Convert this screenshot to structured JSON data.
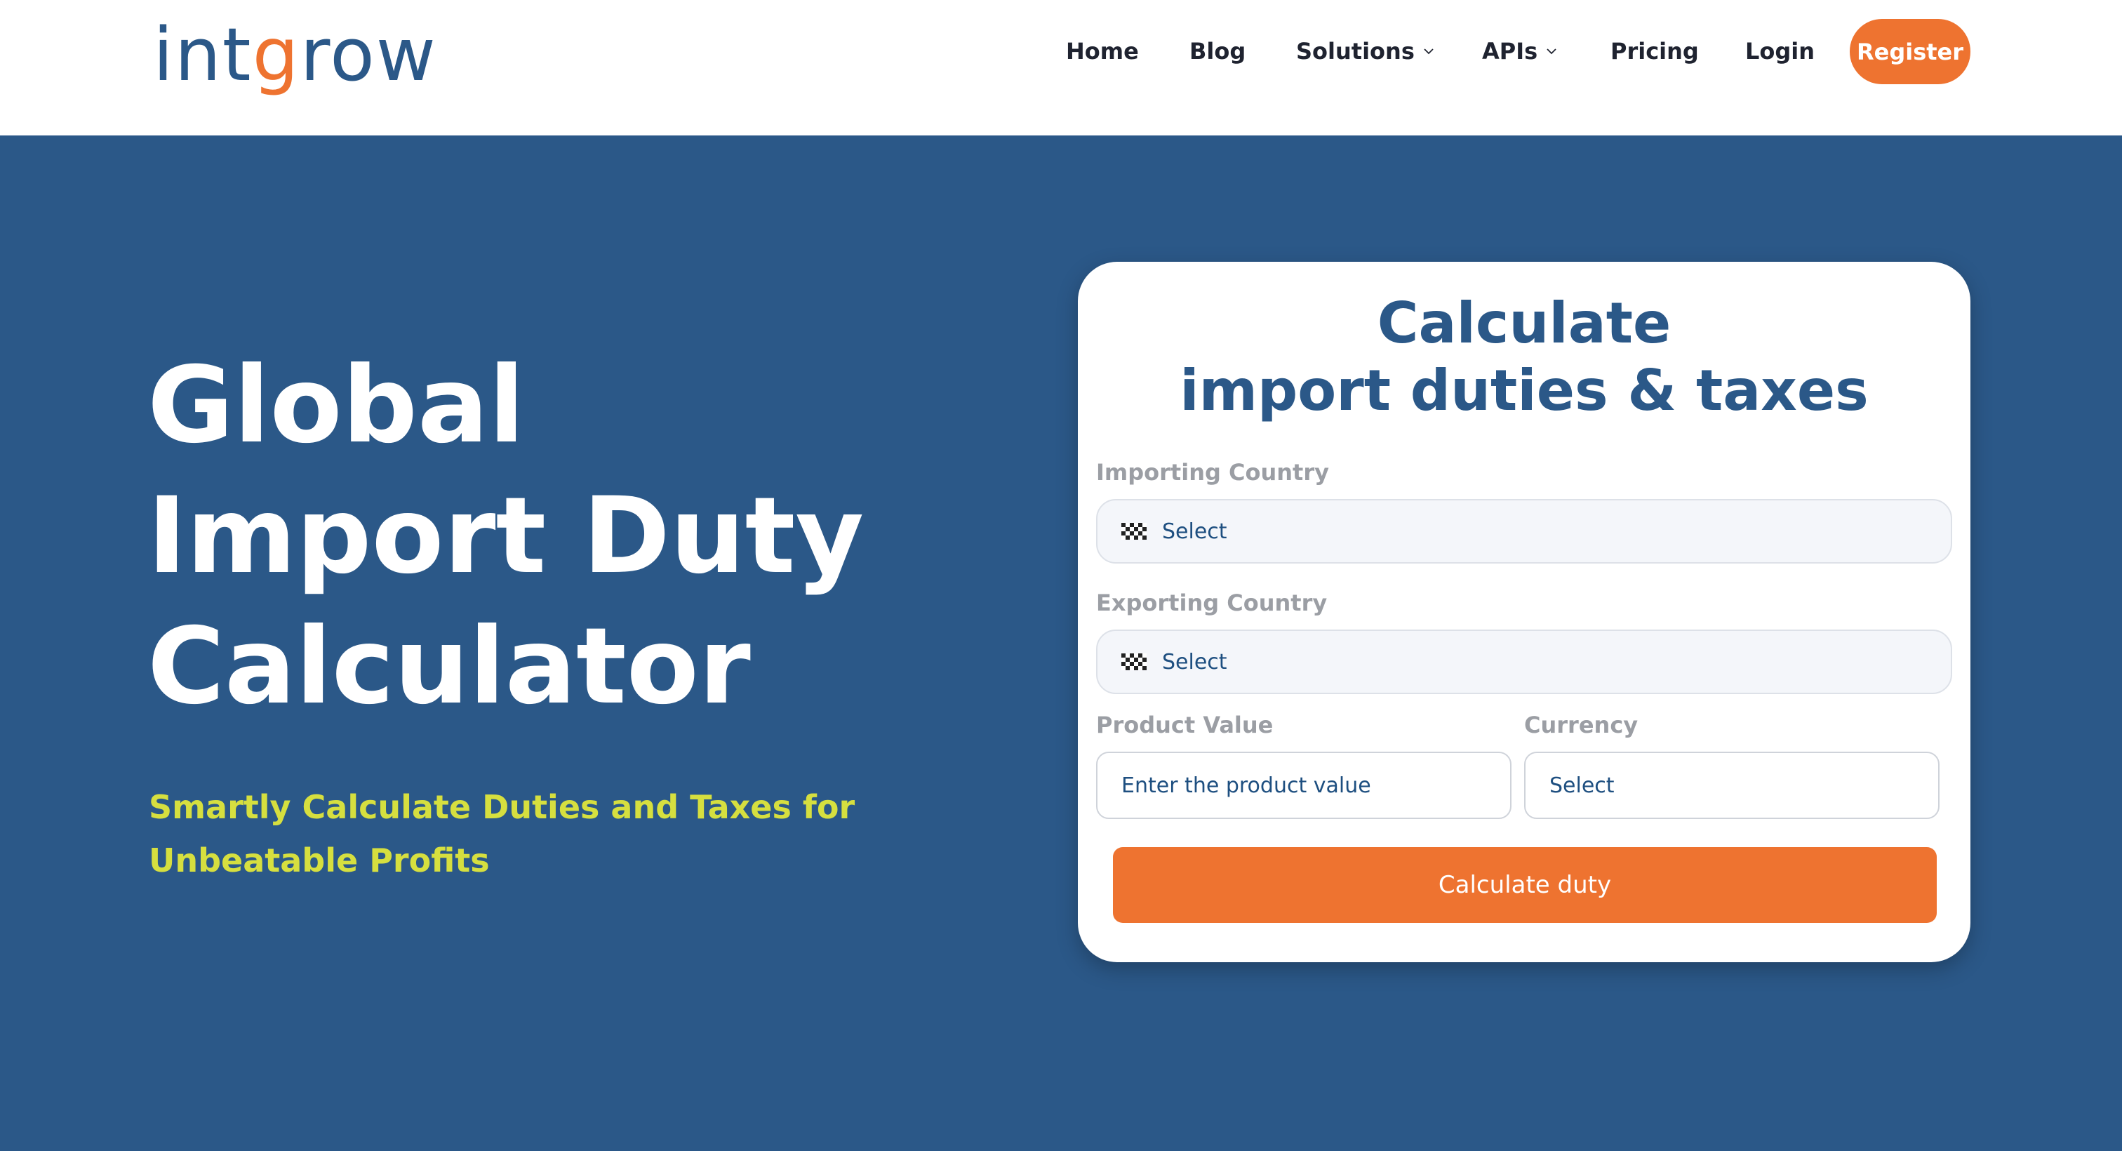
{
  "brand": {
    "logo_start": "int",
    "logo_accent": "g",
    "logo_end": "row",
    "primary_color": "#2b5888",
    "accent_color": "#ee7330"
  },
  "nav": {
    "home": "Home",
    "blog": "Blog",
    "solutions": "Solutions",
    "apis": "APIs",
    "pricing": "Pricing",
    "login": "Login",
    "register": "Register"
  },
  "hero": {
    "title_line1": "Global",
    "title_line2": "Import Duty",
    "title_line3": "Calculator",
    "subtitle": "Smartly Calculate Duties and Taxes for Unbeatable Profits",
    "subtitle_color": "#d6df3f"
  },
  "calculator": {
    "title_line1": "Calculate",
    "title_line2": "import duties & taxes",
    "importing_label": "Importing Country",
    "importing_value": "Select",
    "exporting_label": "Exporting Country",
    "exporting_value": "Select",
    "product_value_label": "Product Value",
    "product_value_placeholder": "Enter the product value",
    "currency_label": "Currency",
    "currency_value": "Select",
    "submit": "Calculate duty",
    "flag_icon": "checkered-flag-icon"
  }
}
